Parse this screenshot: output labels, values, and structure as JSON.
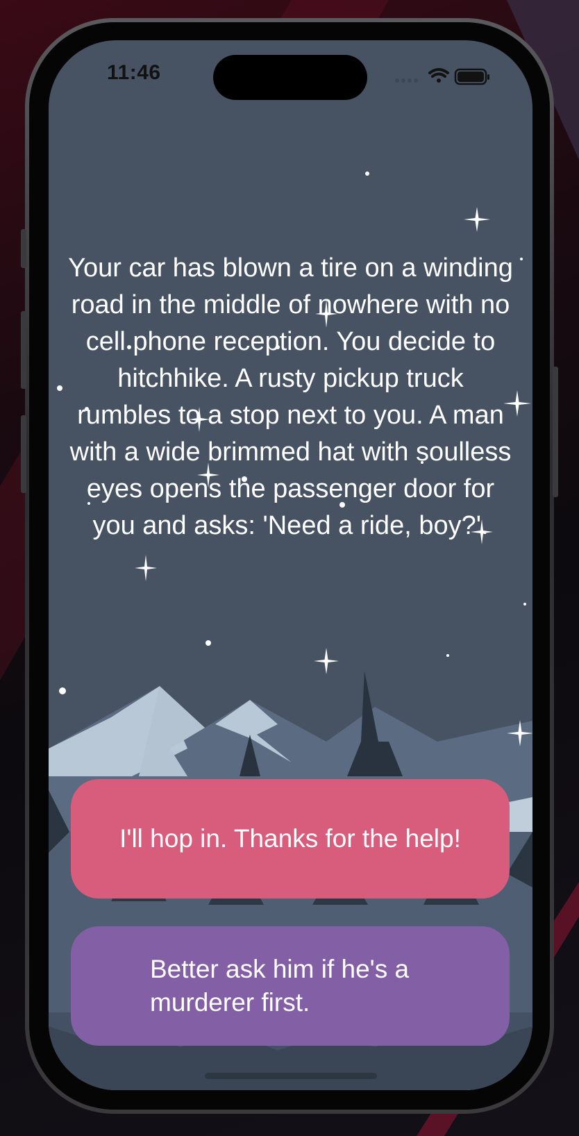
{
  "status_bar": {
    "time": "11:46",
    "icons": [
      "cellular-icon",
      "wifi-icon",
      "battery-icon"
    ]
  },
  "story": {
    "text": "Your car has blown a tire on a winding road in the middle of nowhere with no cell phone reception. You decide to hitchhike. A rusty pickup truck rumbles to a stop next to you. A man with a wide brimmed hat with soulless eyes opens the passenger door for you and asks: 'Need a ride, boy?'."
  },
  "choices": [
    {
      "label": "I'll hop in. Thanks for the help!"
    },
    {
      "label": "Better ask him if he's a murderer first."
    }
  ],
  "colors": {
    "sky": "#475362",
    "choice_primary": "#d85c7c",
    "choice_secondary": "#835fa5",
    "text": "#ffffff"
  }
}
